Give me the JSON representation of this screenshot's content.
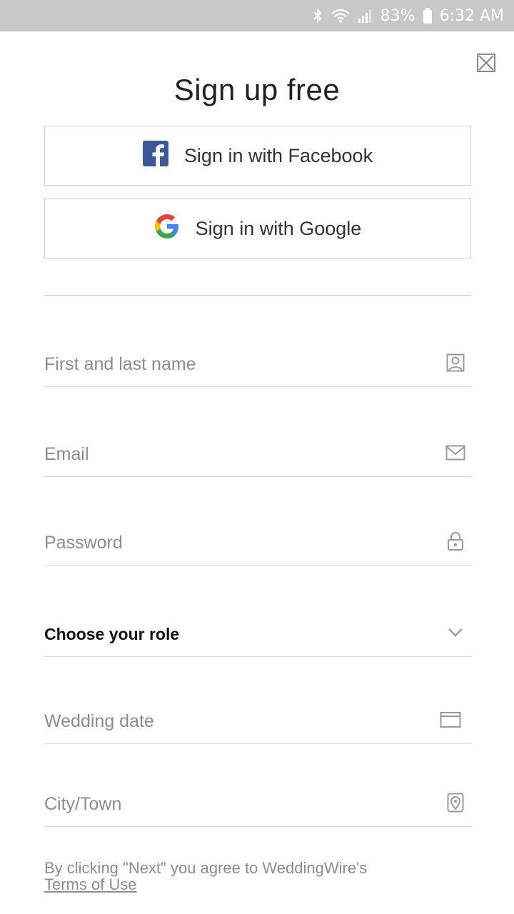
{
  "status_bar": {
    "battery": "83%",
    "time": "6:32 AM"
  },
  "page": {
    "title": "Sign up free"
  },
  "social": {
    "facebook_label": "Sign in with Facebook",
    "google_label": "Sign in with Google"
  },
  "form": {
    "name_placeholder": "First and last name",
    "email_placeholder": "Email",
    "password_placeholder": "Password",
    "role_label": "Choose your role",
    "wedding_date_label": "Wedding date",
    "city_placeholder": "City/Town"
  },
  "legal": {
    "text": "By clicking \"Next\" you agree to WeddingWire's",
    "terms_link": "Terms of Use"
  },
  "colors": {
    "facebook": "#3b5998",
    "status_bar": "#c8c8c8",
    "icon": "#9a9a9a"
  },
  "icons": [
    "bluetooth-icon",
    "wifi-icon",
    "signal-icon",
    "battery-icon",
    "close-icon",
    "facebook-logo-icon",
    "google-logo-icon",
    "person-icon",
    "mail-icon",
    "lock-icon",
    "chevron-down-icon",
    "calendar-icon",
    "location-pin-icon"
  ]
}
